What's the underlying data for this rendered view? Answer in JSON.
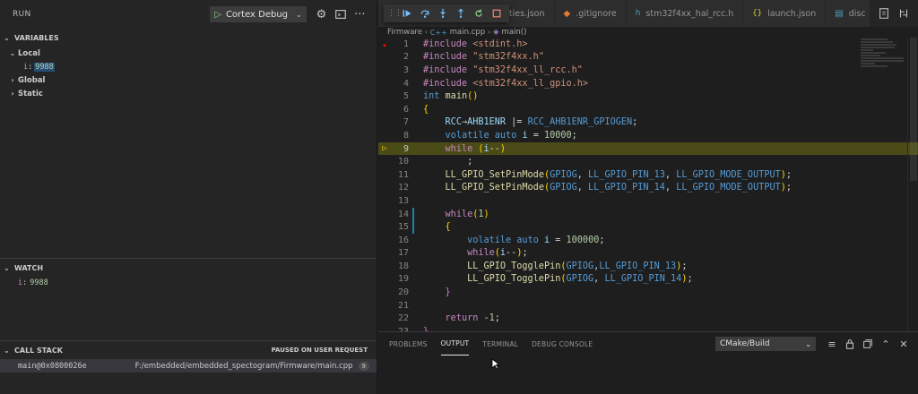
{
  "sidebar": {
    "title": "RUN",
    "config": "Cortex Debug",
    "icons": [
      "play-icon",
      "gear-icon",
      "debug-console-icon",
      "more-icon"
    ],
    "variables_header": "VARIABLES",
    "scopes": [
      {
        "label": "Local",
        "expanded": true
      },
      {
        "label": "Global",
        "expanded": false
      },
      {
        "label": "Static",
        "expanded": false
      }
    ],
    "local_var": {
      "name": "i",
      "sep": ":",
      "value": "9988"
    },
    "watch_header": "WATCH",
    "watch_item": {
      "name": "i",
      "sep": ":",
      "value": "9988"
    },
    "callstack_header": "CALL STACK",
    "callstack_status": "PAUSED ON USER REQUEST",
    "callstack_frame": {
      "fn": "main@0x0800026e",
      "path": "F:/embedded/embedded_spectogram/Firmware/main.cpp",
      "badge": "9"
    }
  },
  "tabs": [
    {
      "label": "rties.json",
      "icon": "json-icon"
    },
    {
      "label": ".gitignore",
      "icon": "git-icon"
    },
    {
      "label": "stm32f4xx_hal_rcc.h",
      "icon": "header-icon"
    },
    {
      "label": "launch.json",
      "icon": "braces-icon"
    },
    {
      "label": "disc",
      "icon": "file-icon"
    }
  ],
  "breadcrumb": {
    "folder": "Firmware",
    "file": "main.cpp",
    "symbol": "main()"
  },
  "editor": {
    "current_line": 9,
    "lines": [
      {
        "n": "1",
        "text": "#include <stdint.h>"
      },
      {
        "n": "2",
        "text": "#include \"stm32f4xx.h\""
      },
      {
        "n": "3",
        "text": "#include \"stm32f4xx_ll_rcc.h\""
      },
      {
        "n": "4",
        "text": "#include <stm32f4xx_ll_gpio.h>"
      },
      {
        "n": "5",
        "text": "int main()"
      },
      {
        "n": "6",
        "text": "{"
      },
      {
        "n": "7",
        "text": "    RCC->AHB1ENR |= RCC_AHB1ENR_GPIOGEN;"
      },
      {
        "n": "8",
        "text": "    volatile auto i = 10000;"
      },
      {
        "n": "9",
        "text": "    while (i--)"
      },
      {
        "n": "10",
        "text": "        ;"
      },
      {
        "n": "11",
        "text": "    LL_GPIO_SetPinMode(GPIOG, LL_GPIO_PIN_13, LL_GPIO_MODE_OUTPUT);"
      },
      {
        "n": "12",
        "text": "    LL_GPIO_SetPinMode(GPIOG, LL_GPIO_PIN_14, LL_GPIO_MODE_OUTPUT);"
      },
      {
        "n": "13",
        "text": ""
      },
      {
        "n": "14",
        "text": "    while(1)"
      },
      {
        "n": "15",
        "text": "    {"
      },
      {
        "n": "16",
        "text": "        volatile auto i = 100000;"
      },
      {
        "n": "17",
        "text": "        while(i--);"
      },
      {
        "n": "18",
        "text": "        LL_GPIO_TogglePin(GPIOG,LL_GPIO_PIN_13);"
      },
      {
        "n": "19",
        "text": "        LL_GPIO_TogglePin(GPIOG, LL_GPIO_PIN_14);"
      },
      {
        "n": "20",
        "text": "    }"
      },
      {
        "n": "21",
        "text": ""
      },
      {
        "n": "22",
        "text": "    return -1;"
      },
      {
        "n": "23",
        "text": "}"
      }
    ]
  },
  "panel": {
    "tabs": [
      "PROBLEMS",
      "OUTPUT",
      "TERMINAL",
      "DEBUG CONSOLE"
    ],
    "active_tab": "OUTPUT",
    "select_value": "CMake/Build"
  },
  "colors": {
    "current_line_bg": "#4b4b18",
    "breakpoint": "#e51400",
    "execution_arrow": "#ffcc00",
    "accent_blue": "#007acc"
  }
}
